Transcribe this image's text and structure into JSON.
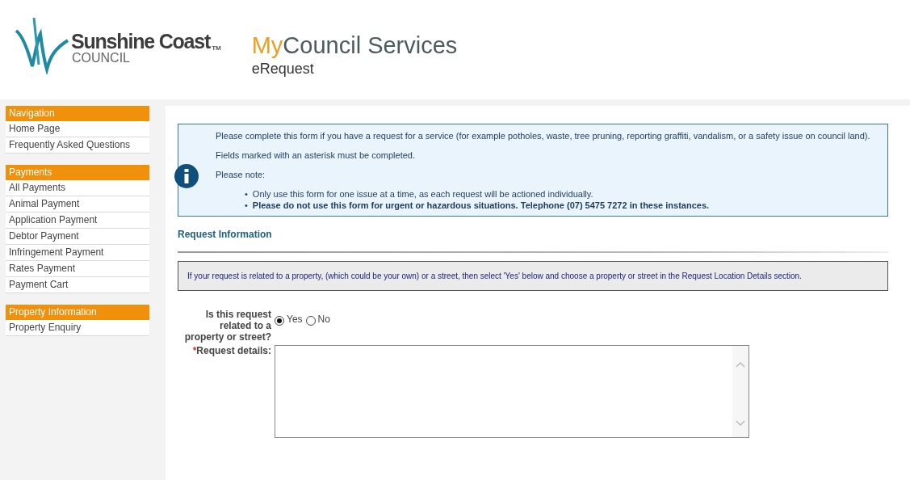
{
  "header": {
    "logo": {
      "name": "Sunshine Coast",
      "trademark": "TM",
      "subtitle": "COUNCIL"
    },
    "title": {
      "accent": "My",
      "rest": "Council Services"
    },
    "subtitle": "eRequest"
  },
  "sidebar": {
    "sections": [
      {
        "title": "Navigation",
        "items": [
          "Home Page",
          "Frequently Asked Questions"
        ]
      },
      {
        "title": "Payments",
        "items": [
          "All Payments",
          "Animal Payment",
          "Application Payment",
          "Debtor Payment",
          "Infringement Payment",
          "Rates Payment",
          "Payment Cart"
        ]
      },
      {
        "title": "Property Information",
        "items": [
          "Property Enquiry"
        ]
      }
    ]
  },
  "info_box": {
    "paragraphs": [
      "Please complete this form if you have a request for a service (for example potholes, waste, tree pruning, reporting graffiti, vandalism, or a safety issue on council land).",
      "Fields marked with an asterisk must be completed.",
      "Please note:"
    ],
    "bullets": [
      {
        "marker": "•",
        "text": "Only use this form for one issue at a time, as each request will be actioned individually.",
        "bold": false
      },
      {
        "marker": "•",
        "text": "Please do not use this form for urgent or hazardous situations. Telephone (07) 5475 7272 in these instances.",
        "bold": true
      }
    ]
  },
  "section_title": "Request Information",
  "notice": "If your request is related to a property, (which could be your own) or a street, then select 'Yes' below and choose a property or street in the Request Location Details section.",
  "form": {
    "question": {
      "label": "Is this request related to a property or street?",
      "options": [
        {
          "label": "Yes",
          "selected": true
        },
        {
          "label": "No",
          "selected": false
        }
      ]
    },
    "details": {
      "required_mark": "*",
      "label": "Request details:"
    }
  }
}
